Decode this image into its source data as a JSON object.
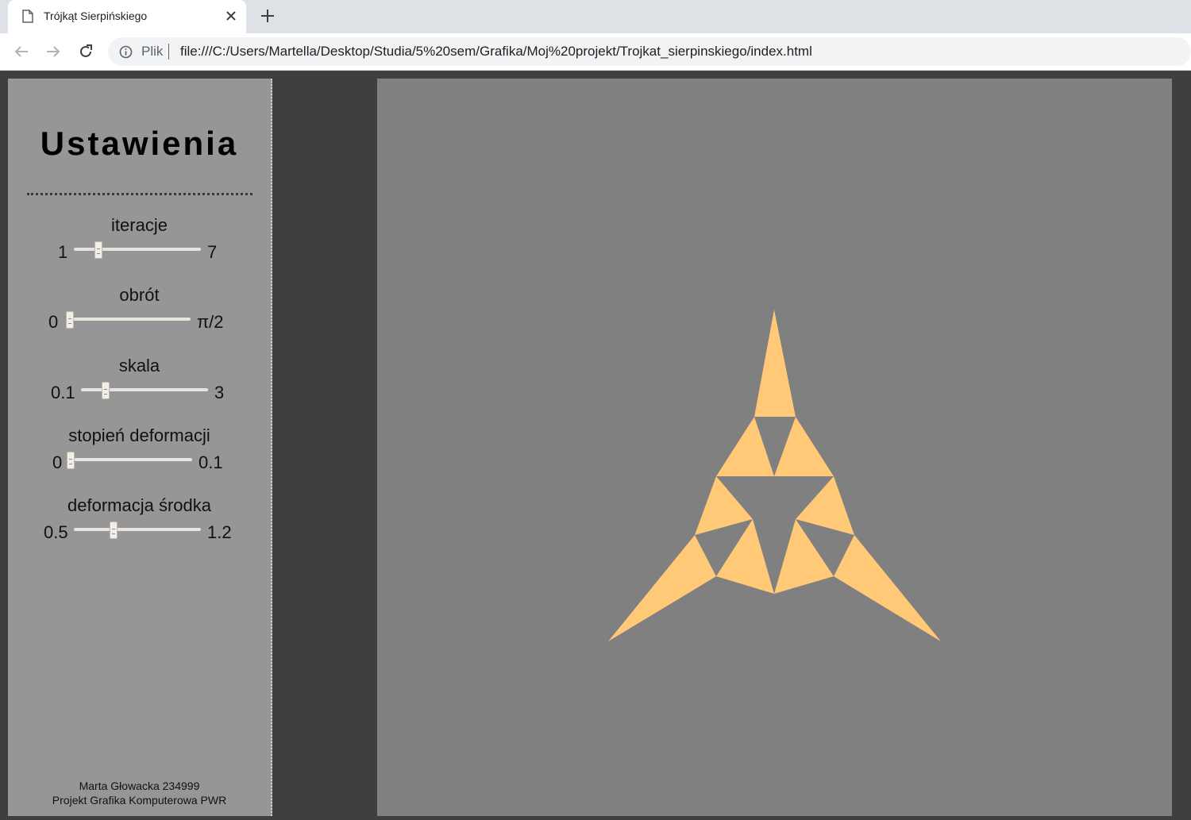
{
  "browser": {
    "tab_title": "Trójkąt Sierpińskiego",
    "security_label": "Plik",
    "url": "file:///C:/Users/Martella/Desktop/Studia/5%20sem/Grafika/Moj%20projekt/Trojkat_sierpinskiego/index.html"
  },
  "settings": {
    "title": "Ustawienia",
    "controls": [
      {
        "label": "iteracje",
        "min": "1",
        "max": "7",
        "value_fraction": 0.2
      },
      {
        "label": "obrót",
        "min": "0",
        "max": "π/2",
        "value_fraction": 0.0
      },
      {
        "label": "skala",
        "min": "0.1",
        "max": "3",
        "value_fraction": 0.2
      },
      {
        "label": "stopień deformacji",
        "min": "0",
        "max": "0.1",
        "value_fraction": 0.0
      },
      {
        "label": "deformacja środka",
        "min": "0.5",
        "max": "1.2",
        "value_fraction": 0.32
      }
    ],
    "credits_line1": "Marta Głowacka 234999",
    "credits_line2": "Projekt Grafika Komputerowa PWR"
  },
  "canvas": {
    "background": "#808080",
    "fill_color": "#ffc977"
  }
}
